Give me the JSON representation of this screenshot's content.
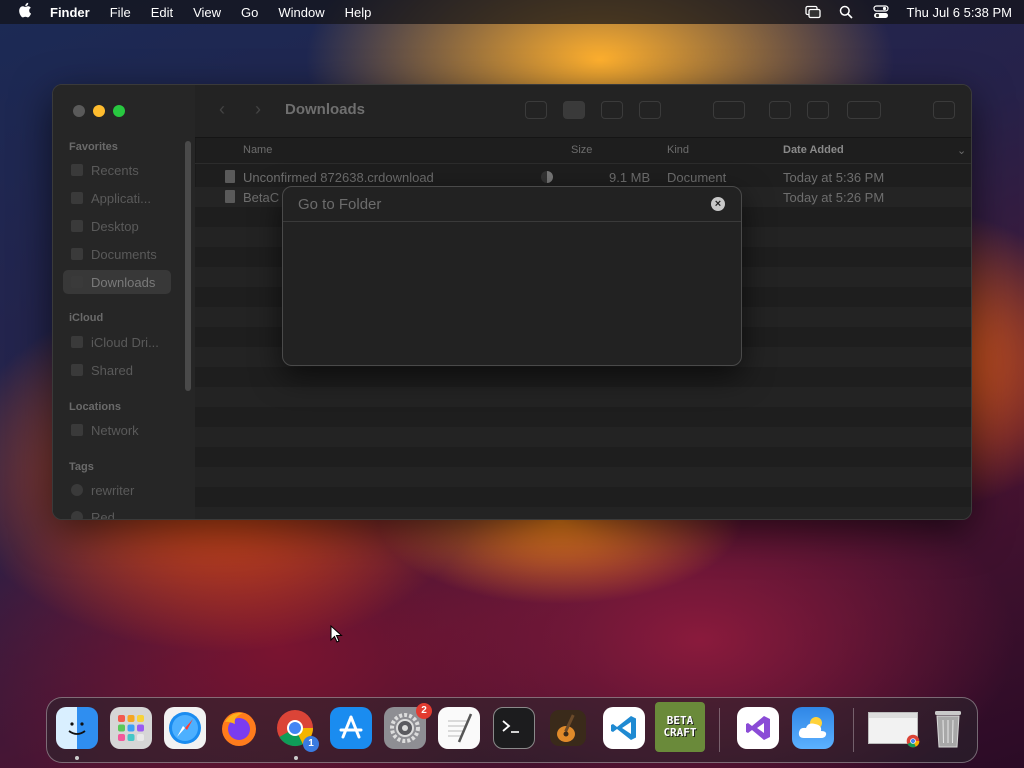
{
  "menubar": {
    "app_name": "Finder",
    "items": [
      "File",
      "Edit",
      "View",
      "Go",
      "Window",
      "Help"
    ],
    "datetime": "Thu Jul 6  5:38 PM"
  },
  "window": {
    "title": "Downloads",
    "sidebar": {
      "favorites_label": "Favorites",
      "favorites": [
        "Recents",
        "Applicati...",
        "Desktop",
        "Documents",
        "Downloads"
      ],
      "icloud_label": "iCloud",
      "icloud": [
        "iCloud Dri...",
        "Shared"
      ],
      "locations_label": "Locations",
      "locations": [
        "Network"
      ],
      "tags_label": "Tags",
      "tags": [
        "rewriter",
        "Red"
      ]
    },
    "columns": {
      "name": "Name",
      "size": "Size",
      "kind": "Kind",
      "date_added": "Date Added"
    },
    "files": [
      {
        "name": "Unconfirmed 872638.crdownload",
        "size": "9.1 MB",
        "kind": "Document",
        "date_added": "Today at 5:36 PM"
      },
      {
        "name": "BetaC",
        "size": "",
        "kind": "",
        "date_added": "Today at 5:26 PM"
      }
    ]
  },
  "dialog": {
    "title": "Go to Folder"
  },
  "dock": {
    "system_settings_badge": "2",
    "chrome_badge": "1",
    "betacraft_label": "BETA CRAFT"
  },
  "colors": {
    "close": "#ff5f57",
    "minimize": "#febc2e",
    "maximize": "#28c840",
    "badge": "#e23b30"
  }
}
